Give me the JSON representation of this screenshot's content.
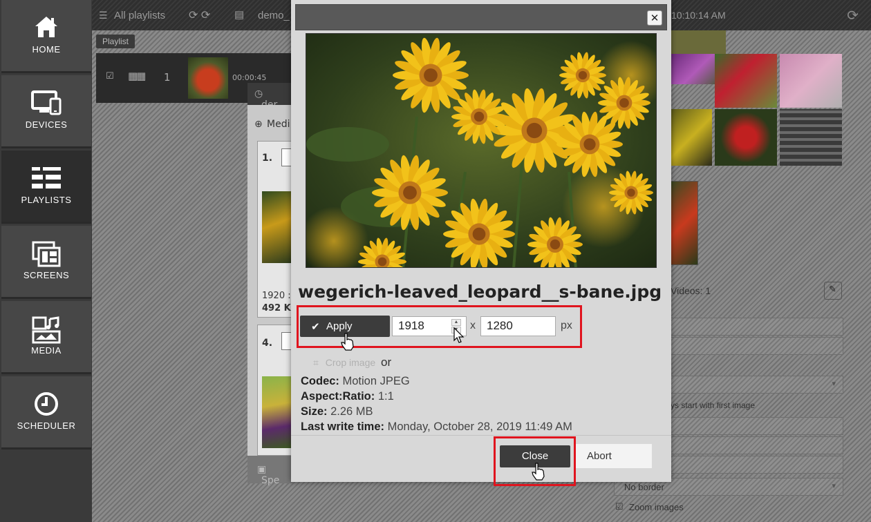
{
  "sidebar": {
    "items": [
      {
        "label": "HOME",
        "icon": "home-icon"
      },
      {
        "label": "DEVICES",
        "icon": "devices-icon"
      },
      {
        "label": "PLAYLISTS",
        "icon": "playlists-icon",
        "active": true
      },
      {
        "label": "SCREENS",
        "icon": "screens-icon"
      },
      {
        "label": "MEDIA",
        "icon": "media-icon"
      },
      {
        "label": "SCHEDULER",
        "icon": "clock-icon"
      }
    ]
  },
  "topbar": {
    "all_playlists": "All playlists",
    "demo_tab": "demo_",
    "time": "10:10:14 AM"
  },
  "playlist": {
    "tag": "Playlist",
    "row_number": "1",
    "row_duration": "00:00:45"
  },
  "mid_panel": {
    "header": "der",
    "media_label": "Medi",
    "item1_num": "1.",
    "item1_res": "1920 :",
    "item1_size": "492 K",
    "item4_num": "4.",
    "footer": "Spe"
  },
  "right_panel": {
    "videos_label": "Videos: 1",
    "start_text": "ys start with first image",
    "border_select": "No border",
    "zoom_label": "Zoom images"
  },
  "modal": {
    "filename": "wegerich-leaved_leopard__s-bane.jpg",
    "apply_label": "Apply",
    "width_value": "1918",
    "height_value": "1280",
    "x_sep": "x",
    "unit": "px",
    "crop_label": "Crop image",
    "or_label": "or",
    "meta": {
      "codec_label": "Codec:",
      "codec_value": "Motion JPEG",
      "aspect_label": "Aspect:Ratio:",
      "aspect_value": "1:1",
      "size_label": "Size:",
      "size_value": "2.26 MB",
      "lwt_label": "Last write time:",
      "lwt_value": "Monday, October 28, 2019 11:49 AM"
    },
    "close_label": "Close",
    "abort_label": "Abort"
  },
  "colors": {
    "highlight": "#e0141e",
    "button_dark": "#3c3c3c",
    "modal_bg": "#d8d8d8",
    "sidebar_bg": "#474747"
  }
}
